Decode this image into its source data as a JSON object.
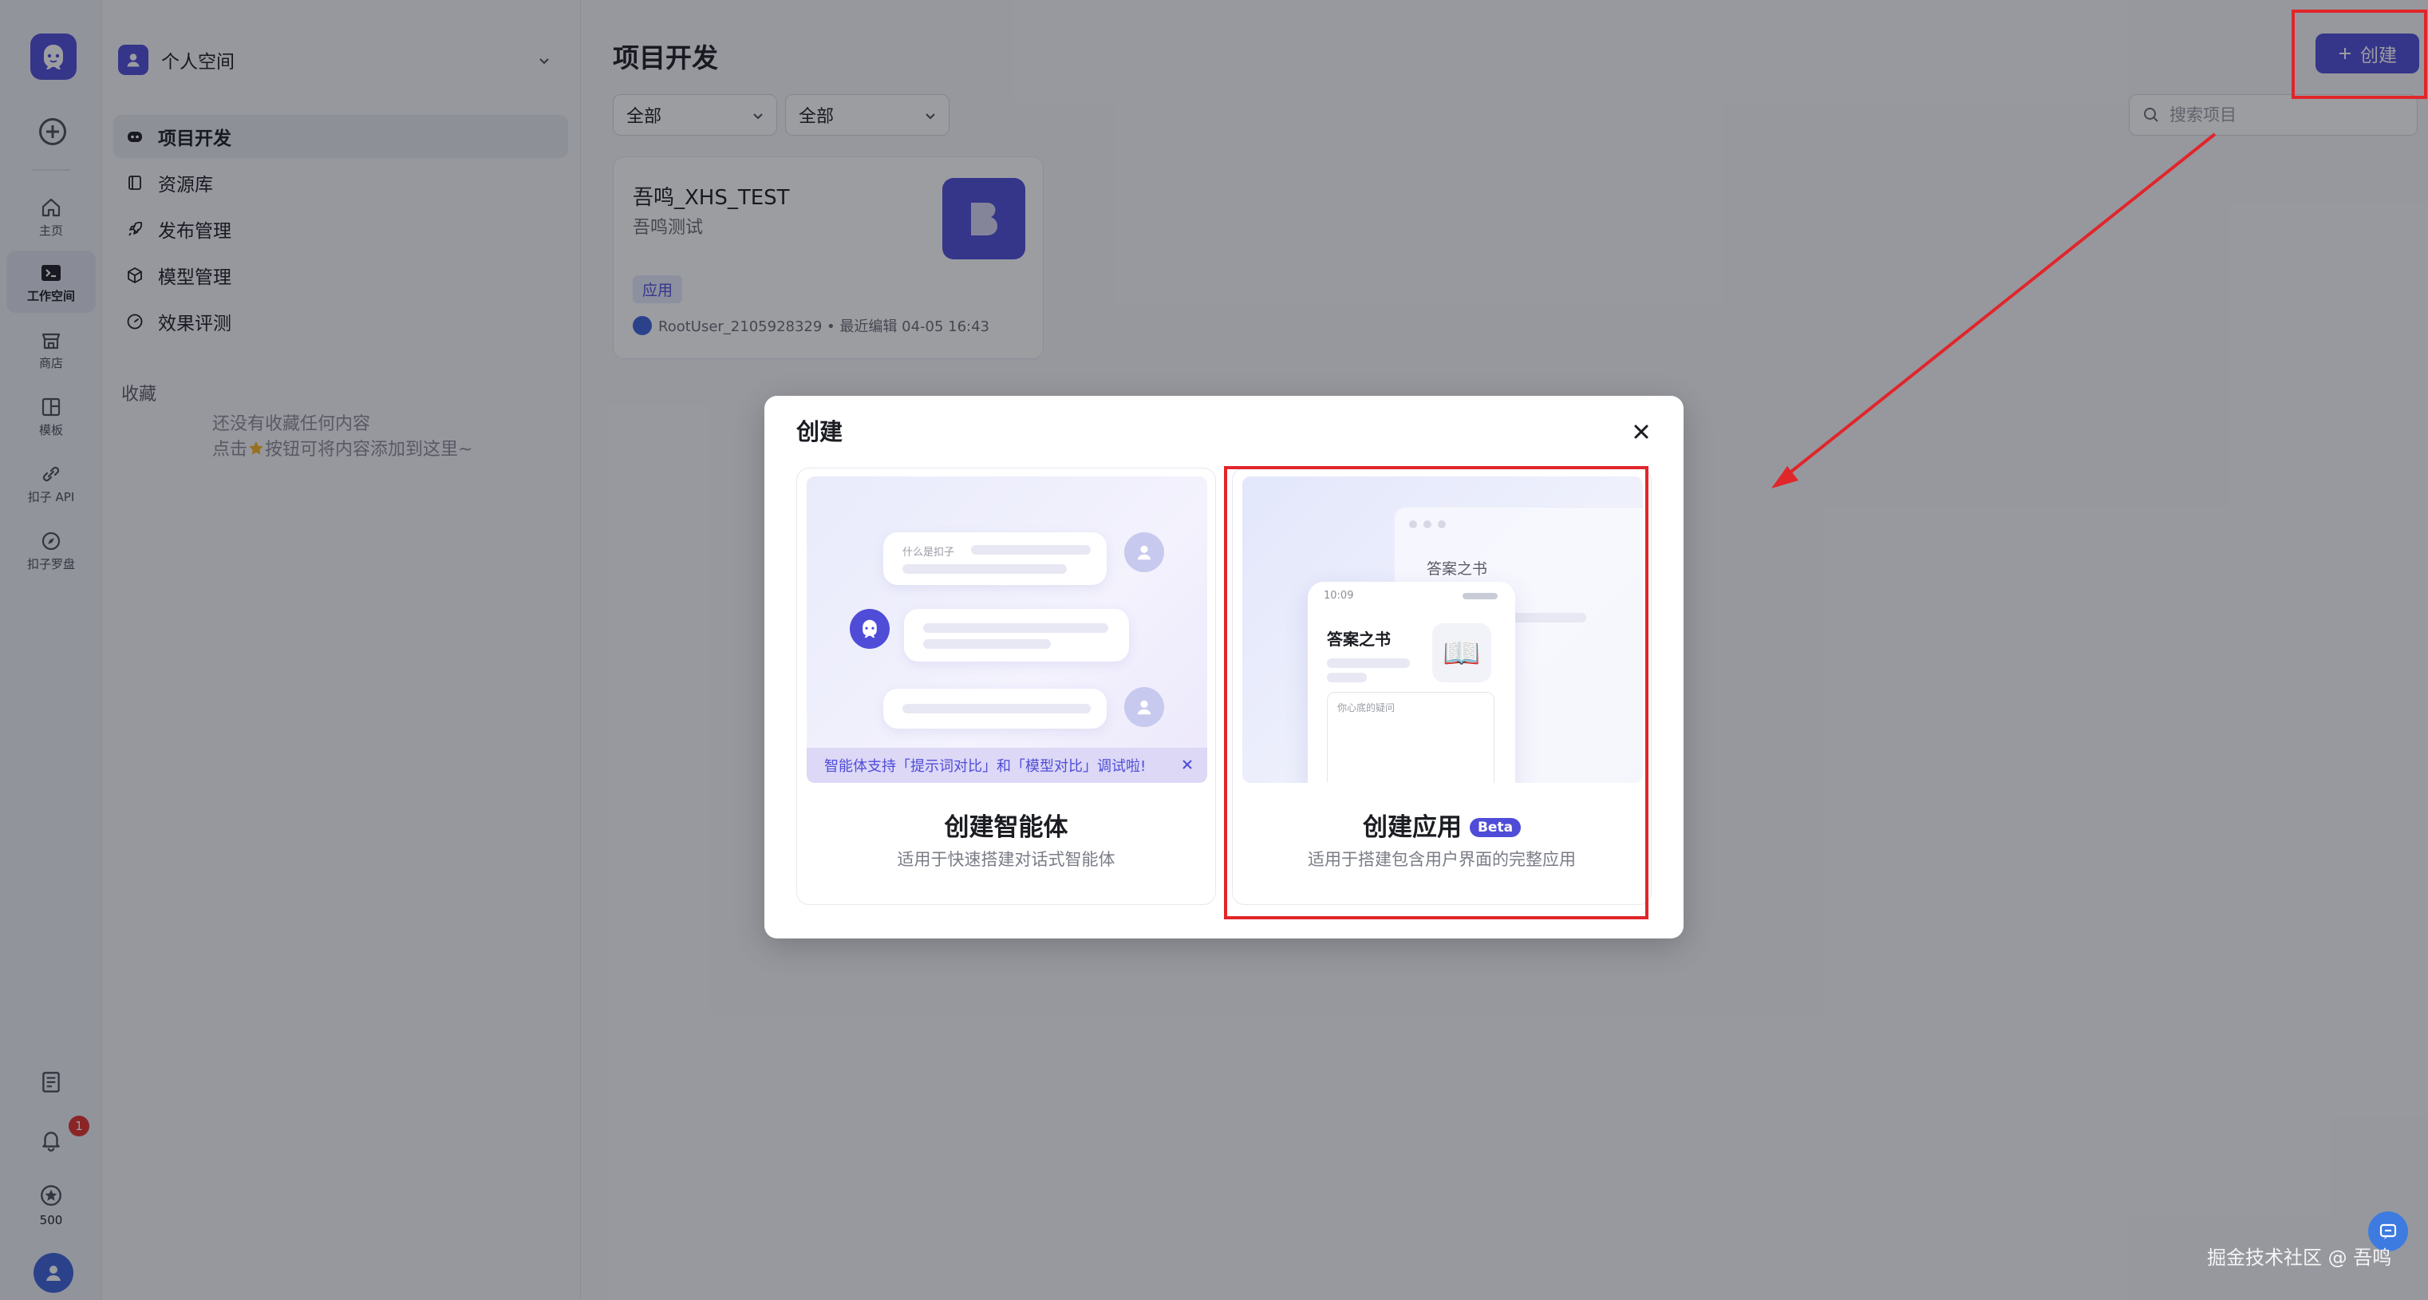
{
  "rail": {
    "items": [
      {
        "name": "home",
        "label": "主页"
      },
      {
        "name": "workspace",
        "label": "工作空间"
      },
      {
        "name": "store",
        "label": "商店"
      },
      {
        "name": "templates",
        "label": "模板"
      },
      {
        "name": "api",
        "label": "扣子 API"
      },
      {
        "name": "compass",
        "label": "扣子罗盘"
      }
    ],
    "notification_count": "1",
    "points": "500"
  },
  "sidebar": {
    "space_name": "个人空间",
    "nav": [
      {
        "label": "项目开发",
        "icon": "bot-icon"
      },
      {
        "label": "资源库",
        "icon": "library-icon"
      },
      {
        "label": "发布管理",
        "icon": "rocket-icon"
      },
      {
        "label": "模型管理",
        "icon": "cube-icon"
      },
      {
        "label": "效果评测",
        "icon": "gauge-icon"
      }
    ],
    "favorites_title": "收藏",
    "favorites_empty_line1": "还没有收藏任何内容",
    "favorites_empty_line2_pre": "点击",
    "favorites_empty_line2_post": "按钮可将内容添加到这里~"
  },
  "main": {
    "title": "项目开发",
    "create_button": "创建",
    "filters": [
      "全部",
      "全部"
    ],
    "search_placeholder": "搜索项目",
    "project": {
      "name": "吾鸣_XHS_TEST",
      "desc": "吾鸣测试",
      "tag": "应用",
      "meta": "RootUser_2105928329 • 最近编辑 04-05 16:43"
    }
  },
  "modal": {
    "title": "创建",
    "agent": {
      "title": "创建智能体",
      "subtitle": "适用于快速搭建对话式智能体",
      "preview_question": "什么是扣子",
      "tip": "智能体支持「提示词对比」和「模型对比」调试啦!"
    },
    "app": {
      "title": "创建应用",
      "badge": "Beta",
      "subtitle": "适用于搭建包含用户界面的完整应用",
      "preview_title": "答案之书",
      "preview_time": "10:09",
      "preview_placeholder": "你心底的疑问",
      "preview_icon": "📖"
    }
  },
  "watermark": "掘金技术社区 @ 吾鸣",
  "colors": {
    "brand": "#4f4cd8",
    "annotation": "#e0262b"
  }
}
